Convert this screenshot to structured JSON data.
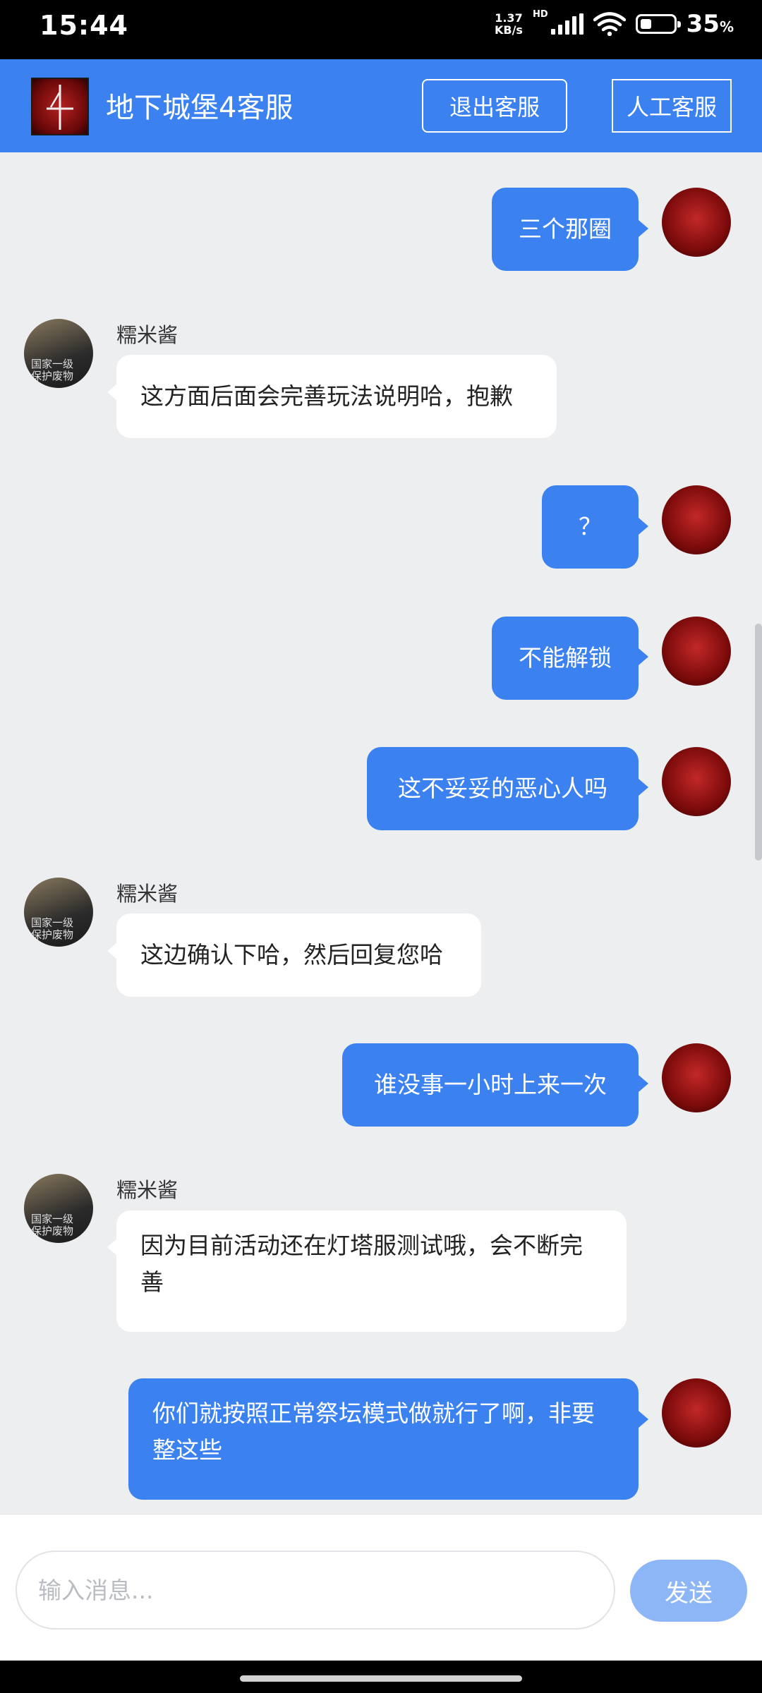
{
  "status": {
    "time": "15:44",
    "speed_top": "1.37",
    "speed_bottom": "KB/s",
    "net": "HD",
    "battery": "35",
    "battery_unit": "%",
    "battery_level": 0.35
  },
  "header": {
    "title": "地下城堡4客服",
    "exit_label": "退出客服",
    "human_label": "人工客服"
  },
  "messages": [
    {
      "from": "me",
      "text": "三个那圈"
    },
    {
      "from": "agent",
      "sender": "糯米酱",
      "text": "这方面后面会完善玩法说明哈，抱歉"
    },
    {
      "from": "me",
      "text": "？"
    },
    {
      "from": "me",
      "text": "不能解锁"
    },
    {
      "from": "me",
      "text": "这不妥妥的恶心人吗"
    },
    {
      "from": "agent",
      "sender": "糯米酱",
      "text": "这边确认下哈，然后回复您哈"
    },
    {
      "from": "me",
      "text": "谁没事一小时上来一次"
    },
    {
      "from": "agent",
      "sender": "糯米酱",
      "text": "因为目前活动还在灯塔服测试哦，会不断完善"
    },
    {
      "from": "me",
      "text": "你们就按照正常祭坛模式做就行了啊，非要整这些"
    }
  ],
  "agent_avatar_watermark": "国家一级\n保护废物",
  "input": {
    "placeholder": "输入消息...",
    "value": ""
  },
  "send_label": "发送",
  "colors": {
    "accent": "#3b82f0",
    "send_disabled": "#8db6f6",
    "background": "#edeef0"
  }
}
